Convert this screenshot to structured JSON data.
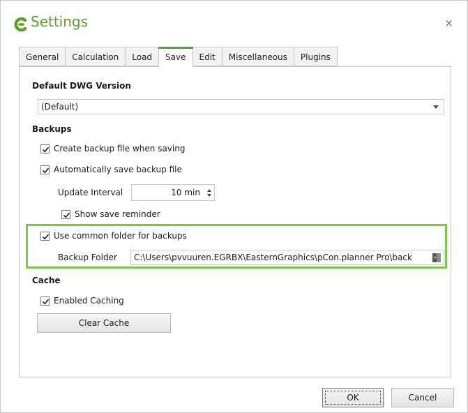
{
  "window": {
    "title": "Settings",
    "close_label": "×"
  },
  "tabs": [
    {
      "label": "General",
      "active": false
    },
    {
      "label": "Calculation",
      "active": false
    },
    {
      "label": "Load",
      "active": false
    },
    {
      "label": "Save",
      "active": true
    },
    {
      "label": "Edit",
      "active": false
    },
    {
      "label": "Miscellaneous",
      "active": false
    },
    {
      "label": "Plugins",
      "active": false
    }
  ],
  "save": {
    "dwg_heading": "Default DWG Version",
    "dwg_value": "(Default)",
    "backups_heading": "Backups",
    "create_backup_label": "Create backup file when saving",
    "create_backup_checked": true,
    "auto_save_label": "Automatically save backup file",
    "auto_save_checked": true,
    "interval_label": "Update Interval",
    "interval_value": "10 min",
    "reminder_label": "Show save reminder",
    "reminder_checked": true,
    "common_folder_label": "Use common folder for backups",
    "common_folder_checked": true,
    "folder_label": "Backup Folder",
    "folder_value": "C:\\Users\\pvvuuren.EGRBX\\EasternGraphics\\pCon.planner Pro\\back",
    "cache_heading": "Cache",
    "caching_label": "Enabled Caching",
    "caching_checked": true,
    "clear_cache_label": "Clear Cache"
  },
  "buttons": {
    "ok": "OK",
    "cancel": "Cancel"
  },
  "colors": {
    "accent": "#5aa12b",
    "highlight": "#7ac943"
  },
  "icons": {
    "logo": "pcon-logo-icon",
    "close": "close-icon",
    "folder": "folder-browse-icon"
  }
}
